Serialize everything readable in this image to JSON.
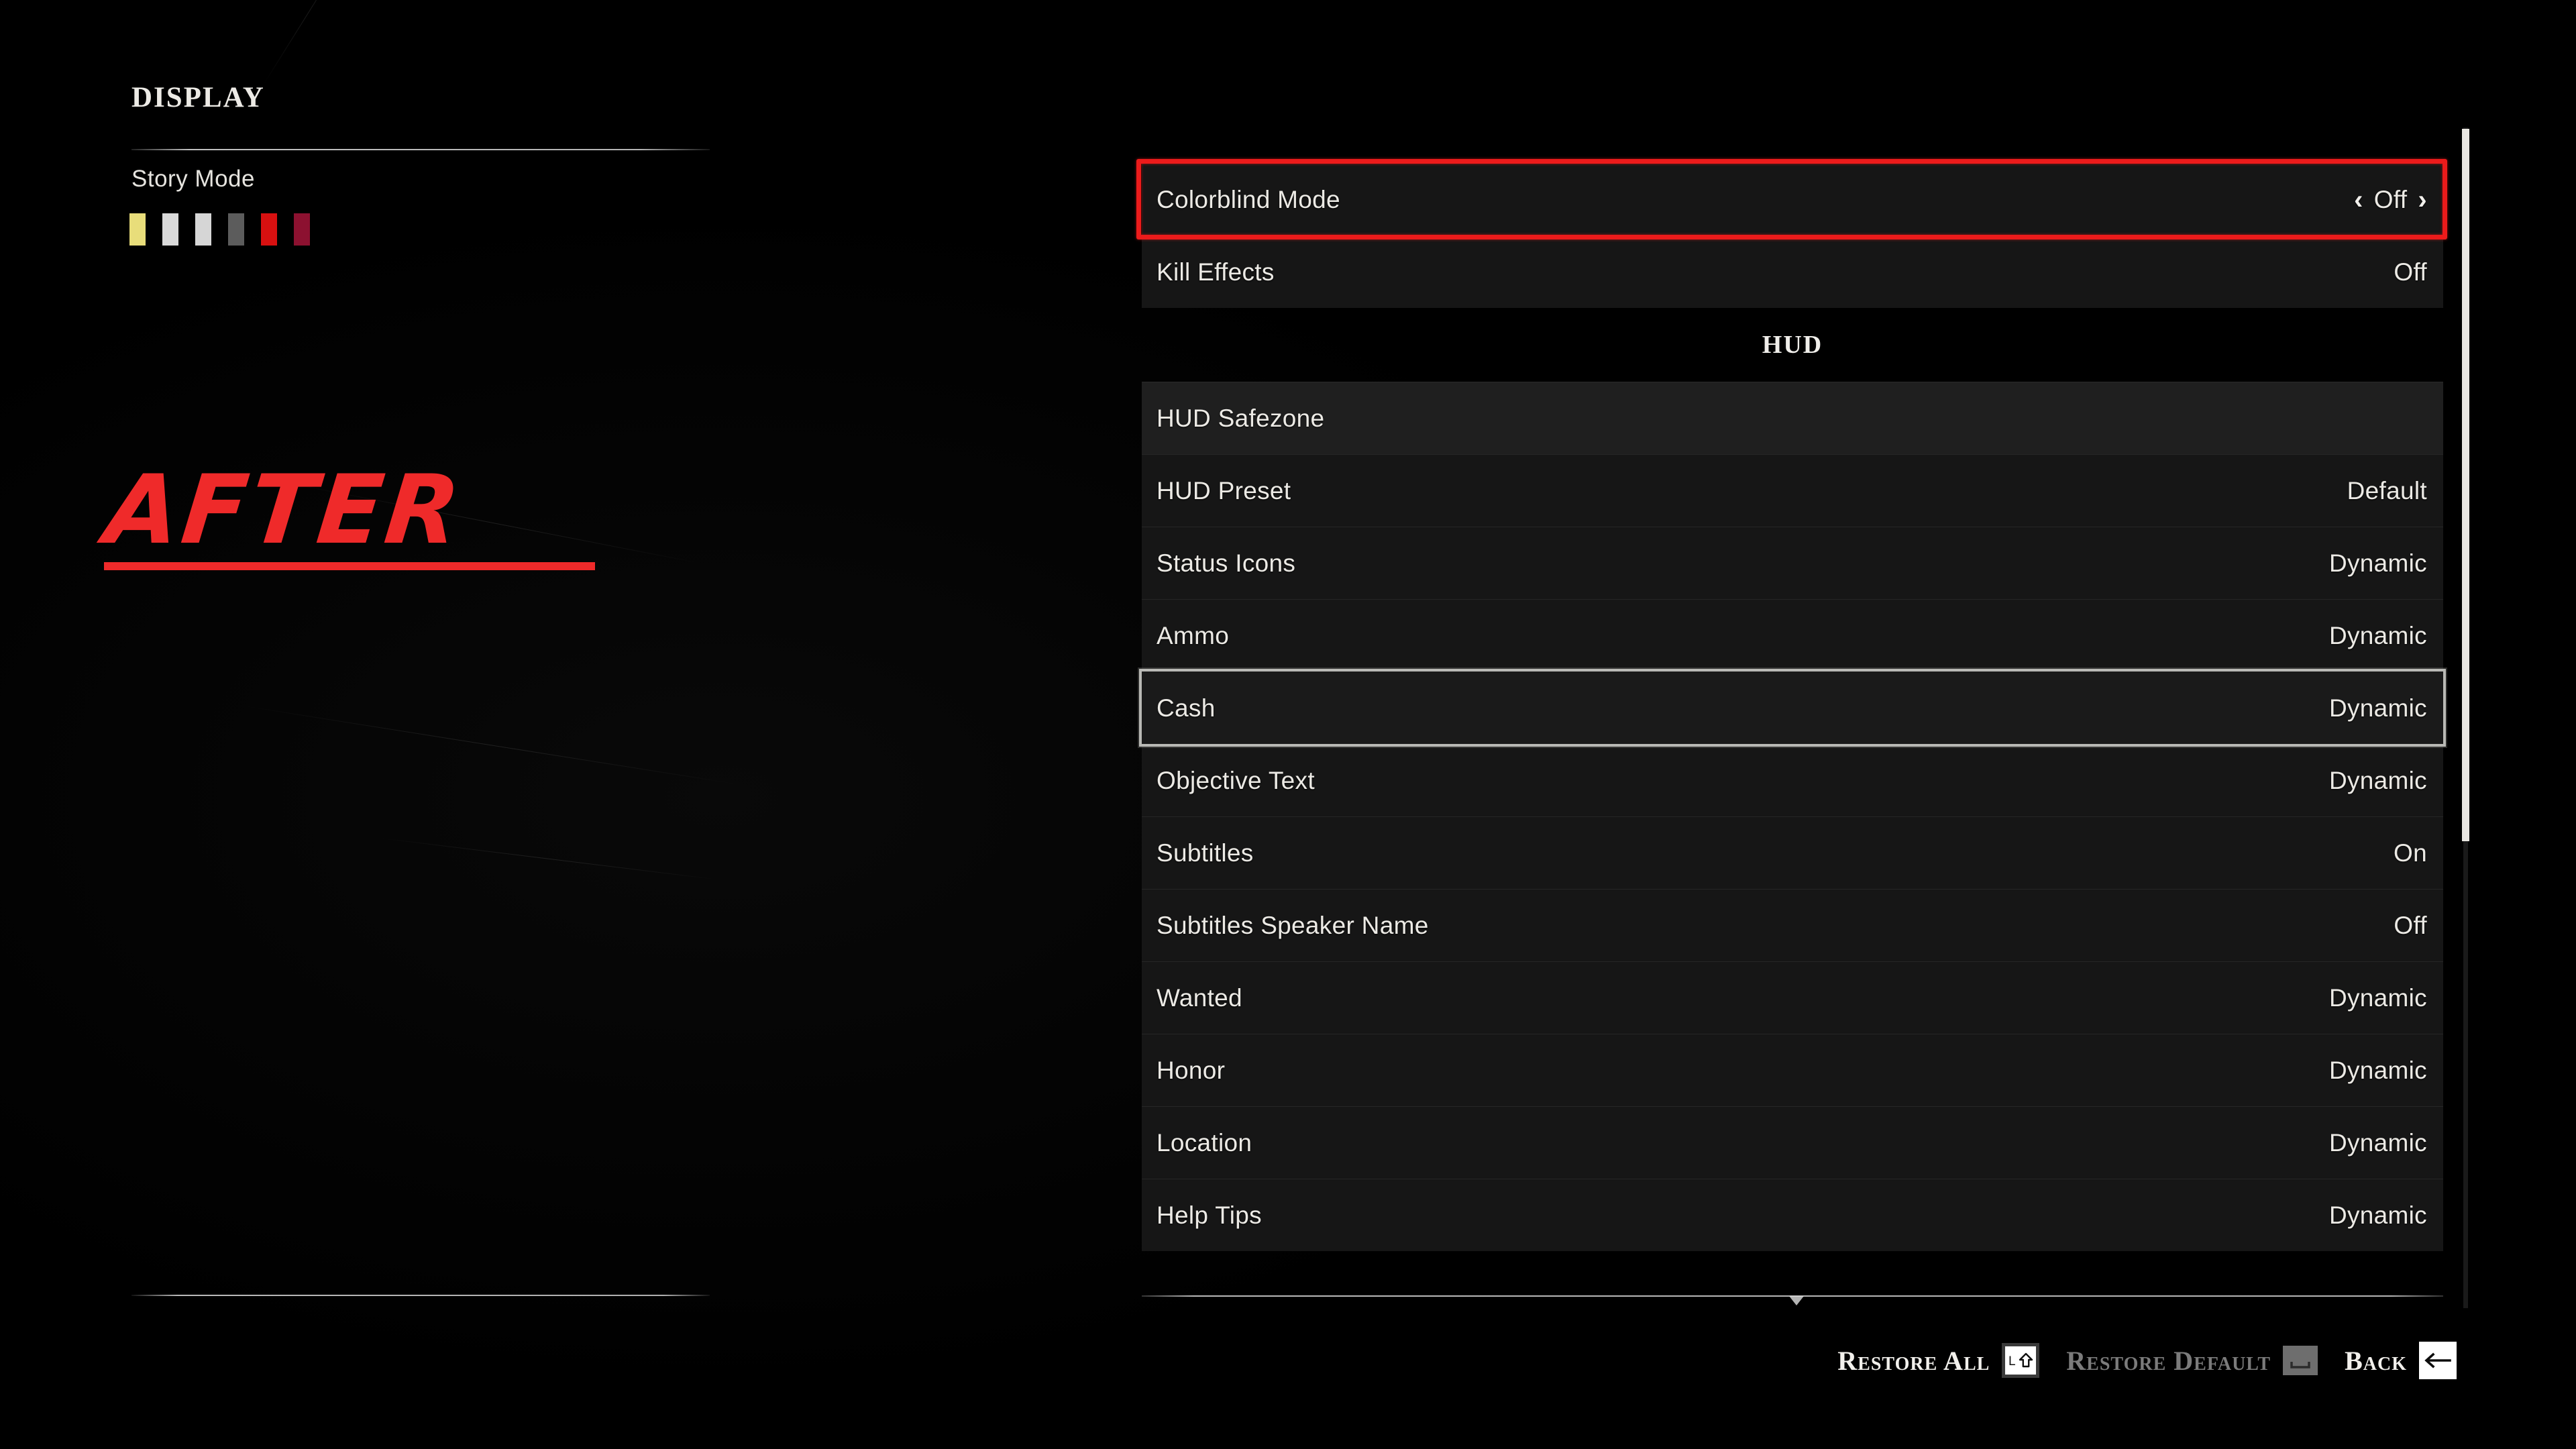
{
  "left": {
    "page_title": "Display",
    "mode_label": "Story Mode",
    "swatches": [
      {
        "name": "swatch-yellow",
        "color": "#e8dd7a"
      },
      {
        "name": "swatch-light-gray-1",
        "color": "#d9d9d9"
      },
      {
        "name": "swatch-light-gray-2",
        "color": "#d6d6d6"
      },
      {
        "name": "swatch-dark-gray",
        "color": "#5c5c5c"
      },
      {
        "name": "swatch-red",
        "color": "#d81010"
      },
      {
        "name": "swatch-dark-red",
        "color": "#8c1130"
      }
    ],
    "annotation_text": "AFTER",
    "annotation_color": "#ef2a2a"
  },
  "settings": {
    "rows": [
      {
        "label": "Colorblind Mode",
        "value": "Off",
        "selected": false,
        "annotated": true,
        "stepper": true,
        "light": false
      },
      {
        "label": "Kill Effects",
        "value": "Off",
        "selected": false,
        "annotated": false,
        "stepper": false,
        "light": false
      }
    ],
    "section": {
      "header": "HUD",
      "rows": [
        {
          "label": "HUD Safezone",
          "value": "",
          "selected": false,
          "stepper": false,
          "light": true
        },
        {
          "label": "HUD Preset",
          "value": "Default",
          "selected": false,
          "stepper": false,
          "light": false
        },
        {
          "label": "Status Icons",
          "value": "Dynamic",
          "selected": false,
          "stepper": false,
          "light": false
        },
        {
          "label": "Ammo",
          "value": "Dynamic",
          "selected": false,
          "stepper": false,
          "light": false
        },
        {
          "label": "Cash",
          "value": "Dynamic",
          "selected": true,
          "stepper": false,
          "light": false
        },
        {
          "label": "Objective Text",
          "value": "Dynamic",
          "selected": false,
          "stepper": false,
          "light": false
        },
        {
          "label": "Subtitles",
          "value": "On",
          "selected": false,
          "stepper": false,
          "light": false
        },
        {
          "label": "Subtitles Speaker Name",
          "value": "Off",
          "selected": false,
          "stepper": false,
          "light": false
        },
        {
          "label": "Wanted",
          "value": "Dynamic",
          "selected": false,
          "stepper": false,
          "light": false
        },
        {
          "label": "Honor",
          "value": "Dynamic",
          "selected": false,
          "stepper": false,
          "light": false
        },
        {
          "label": "Location",
          "value": "Dynamic",
          "selected": false,
          "stepper": false,
          "light": false
        },
        {
          "label": "Help Tips",
          "value": "Dynamic",
          "selected": false,
          "stepper": false,
          "light": false
        }
      ]
    },
    "stepper": {
      "prev": "‹",
      "next": "›"
    }
  },
  "action_bar": {
    "actions": [
      {
        "label": "Restore All",
        "key": "lshift",
        "key_text": "L",
        "disabled": false
      },
      {
        "label": "Restore Default",
        "key": "spacebar",
        "key_text": "",
        "disabled": true
      },
      {
        "label": "Back",
        "key": "backspace",
        "key_text": "",
        "disabled": false
      }
    ]
  },
  "colors": {
    "accent_red": "#ec1b1b",
    "text_primary": "#eceae5",
    "text_disabled": "#7b7b7b",
    "row_bg": "#161616",
    "row_bg_light": "#1f1f1f",
    "selection_border": "#b9b9b5"
  }
}
